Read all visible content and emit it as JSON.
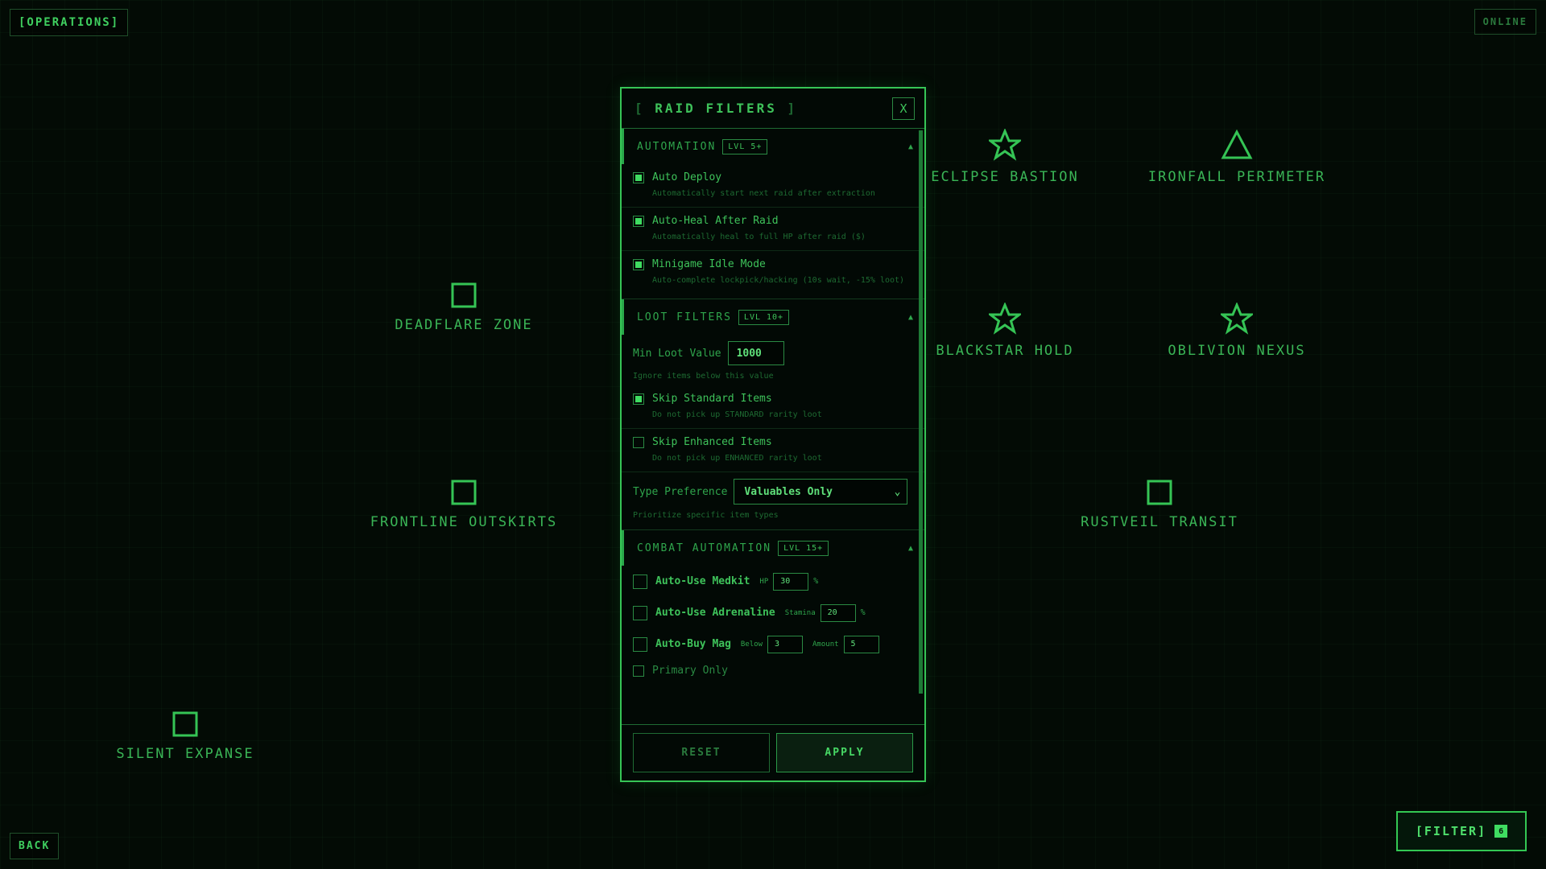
{
  "top": {
    "operations": "[OPERATIONS]",
    "status": "ONLINE"
  },
  "bottom": {
    "back": "BACK",
    "filter": "[FILTER]",
    "filter_count": "6"
  },
  "zones": [
    {
      "name": "ECLIPSE BASTION",
      "icon": "star-icon"
    },
    {
      "name": "IRONFALL PERIMETER",
      "icon": "triangle-icon"
    },
    {
      "name": "DEADFLARE ZONE",
      "icon": "square-icon"
    },
    {
      "name": "BLACKSTAR HOLD",
      "icon": "star-icon"
    },
    {
      "name": "OBLIVION NEXUS",
      "icon": "star-icon"
    },
    {
      "name": "FRONTLINE OUTSKIRTS",
      "icon": "square-icon"
    },
    {
      "name": "RUSTVEIL TRANSIT",
      "icon": "square-icon"
    },
    {
      "name": "SILENT EXPANSE",
      "icon": "square-icon"
    }
  ],
  "modal": {
    "title_open": "[",
    "title": "RAID FILTERS",
    "title_close": "]",
    "close": "X",
    "automation": {
      "title": "AUTOMATION",
      "level": "LVL 5+",
      "options": [
        {
          "label": "Auto Deploy",
          "desc": "Automatically start next raid after extraction",
          "checked": true
        },
        {
          "label": "Auto-Heal After Raid",
          "desc": "Automatically heal to full HP after raid ($)",
          "checked": true
        },
        {
          "label": "Minigame Idle Mode",
          "desc": "Auto-complete lockpick/hacking (10s wait, -15% loot)",
          "checked": true
        }
      ]
    },
    "loot": {
      "title": "LOOT FILTERS",
      "level": "LVL 10+",
      "min_label": "Min Loot Value",
      "min_value": "1000",
      "min_hint": "Ignore items below this value",
      "options": [
        {
          "label": "Skip Standard Items",
          "desc": "Do not pick up STANDARD rarity loot",
          "checked": true
        },
        {
          "label": "Skip Enhanced Items",
          "desc": "Do not pick up ENHANCED rarity loot",
          "checked": false
        }
      ],
      "type_label": "Type Preference",
      "type_value": "Valuables Only",
      "type_hint": "Prioritize specific item types"
    },
    "combat": {
      "title": "COMBAT AUTOMATION",
      "level": "LVL 15+",
      "medkit": {
        "label": "Auto-Use Medkit",
        "field": "HP",
        "value": "30",
        "unit": "%"
      },
      "adrenaline": {
        "label": "Auto-Use Adrenaline",
        "field": "Stamina",
        "value": "20",
        "unit": "%"
      },
      "mag": {
        "label": "Auto-Buy Mag",
        "below_label": "Below",
        "below": "3",
        "amount_label": "Amount",
        "amount": "5"
      },
      "primary": {
        "label": "Primary Only"
      }
    },
    "reset": "RESET",
    "apply": "APPLY"
  },
  "colors": {
    "accent": "#3fdc61",
    "background": "#030b05",
    "border": "#36c556"
  }
}
